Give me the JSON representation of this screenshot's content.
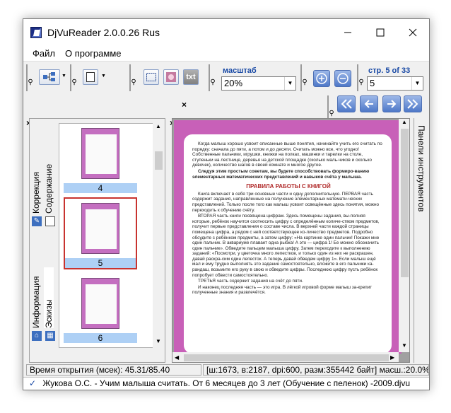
{
  "window": {
    "title": "DjVuReader 2.0.0.26 Rus"
  },
  "menu": {
    "file": "Файл",
    "about": "О программе"
  },
  "toolbar": {
    "txt_label": "txt",
    "zoom_label": "масштаб",
    "zoom_value": "20%",
    "page_label": "стр. 5 of 33",
    "page_value": "5"
  },
  "left_panel": {
    "tab_correction": "Коррекция",
    "tab_contents": "Содержание",
    "tab_info": "Информация",
    "tab_sketches": "Эскизы",
    "thumbnails": [
      {
        "number": "4"
      },
      {
        "number": "5"
      },
      {
        "number": "6"
      }
    ]
  },
  "right_panel": {
    "label": "Панели инструментов"
  },
  "document": {
    "p1": "Когда малыш хорошо усвоит описанные выше понятия, начинайте учить его считать по порядку: сначала до пяти, а потом и до десяти. Считать можно все, что угодно! Собственные пальчики, игрушки, книжки на полках, машинки и тарелки на столе, ступеньки на лестнице, деревья на детской площадке (сколько маль-чиков и сколько девочек), количество шагов в своей комнате и многое другое.",
    "p2": "Следуя этим простым советам, вы будете способствовать формиро-ванию элементарных математических представлений и навыков счёта у малыша.",
    "heading": "ПРАВИЛА РАБОТЫ С КНИГОЙ",
    "p3": "Книга включает в себя три основные части и одну дополнительную. ПЕРВАЯ часть содержит задания, направленные на получение элементарных математи-ческих представлений. Только после того как малыш усвоит освещённые здесь понятия, можно переходить к обучению счёту.",
    "p4": "ВТОРАЯ часть книги посвящена цифрам. Здесь помещены задания, вы-полняя которые, ребёнок научится соотносить цифру с определённым количе-ством предметов, получит первые представления о составе числа. В верхней части каждой страницы помещена цифра, а рядом с ней соответствующее ко-личество предметов. Подробно обсудите с ребёнком предметы, а затем цифру: «На картинке один пальчик! Покажи мне один пальчик. В аквариуме плавает одна рыбка! А это — цифра 1! Ее можно обозначить один пальчик». Обведите пальцем малыша цифру. Затем переходите к выполнению заданий: «Посмотри, у цветочка много лепестков, и только один из них не раскрашен, давай раскра-сим один лепесток. А теперь давай обведем цифру 1». Если малыш ещё мал и ему трудно выполнять это задание самостоятельно, вложите в его пальчики ка-рандаш, возьмите его руку в свою и обведите цифры. Последнюю цифру пусть ребёнок попробует обвести самостоятельно.",
    "p5": "ТРЕТЬЯ часть содержит задания на счёт до пяти.",
    "p6": "И наконец последняя часть — это игра. В лёгкой игровой форме малыш за-крепит полученные знания и развлечётся."
  },
  "status": {
    "open_time": "Время открытия (мсек): 45.31/85.40",
    "info": "[ш:1673, в:2187, dpi:600, разм:355442 байт] масш.:20.0%(3",
    "file": "Жукова О.С. - Учим малыша считать. От 6 месяцев до 3 лет (Обучение с пеленок)  -2009.djvu"
  },
  "colors": {
    "page_border": "#c860b8",
    "selection": "#aed0f5",
    "nav_button": "#4e78c8"
  }
}
